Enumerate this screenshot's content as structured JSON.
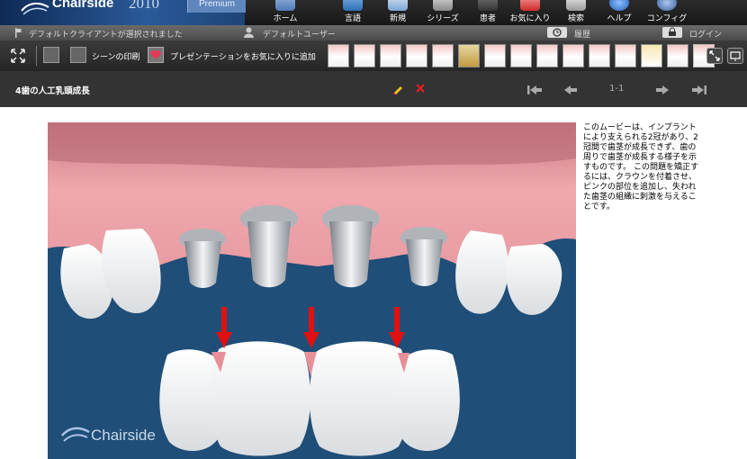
{
  "app": {
    "name": "Chairside",
    "year": "2010",
    "edition": "Premium"
  },
  "nav": [
    {
      "label": "ホーム",
      "icon": "home-icon"
    },
    {
      "label": "言語",
      "icon": "language-icon"
    },
    {
      "label": "新規",
      "icon": "new-icon"
    },
    {
      "label": "シリーズ",
      "icon": "series-icon"
    },
    {
      "label": "患者",
      "icon": "patient-icon"
    },
    {
      "label": "お気に入り",
      "icon": "favorite-icon"
    },
    {
      "label": "検索",
      "icon": "search-icon"
    },
    {
      "label": "ヘルプ",
      "icon": "help-icon"
    },
    {
      "label": "コンフィグ",
      "icon": "config-icon"
    }
  ],
  "status": {
    "client": "デフォルトクライアントが選択されました",
    "user": "デフォルトユーザー",
    "history": "履歴",
    "login": "ログイン"
  },
  "toolbar": {
    "print_scene": "シーンの印刷",
    "add_presentation": "プレゼンテーションをお気に入りに追加"
  },
  "movie": {
    "title": "4歯の人工乳頭成長",
    "page": "1-1",
    "description": "このムービーは、インプラントにより支えられる2冠があり、2冠間で歯茎が成長できず、歯の周りで歯茎が成長する様子を示すものです。 この問題を矯正するには、クラウンを付着させ、ピンクの部位を追加し、失われた歯茎の組織に刺激を与えることです。",
    "watermark": "Chairside"
  },
  "colors": {
    "accent": "#2a5a99",
    "video_bg": "#1f4e78",
    "arrow": "#e01010"
  }
}
